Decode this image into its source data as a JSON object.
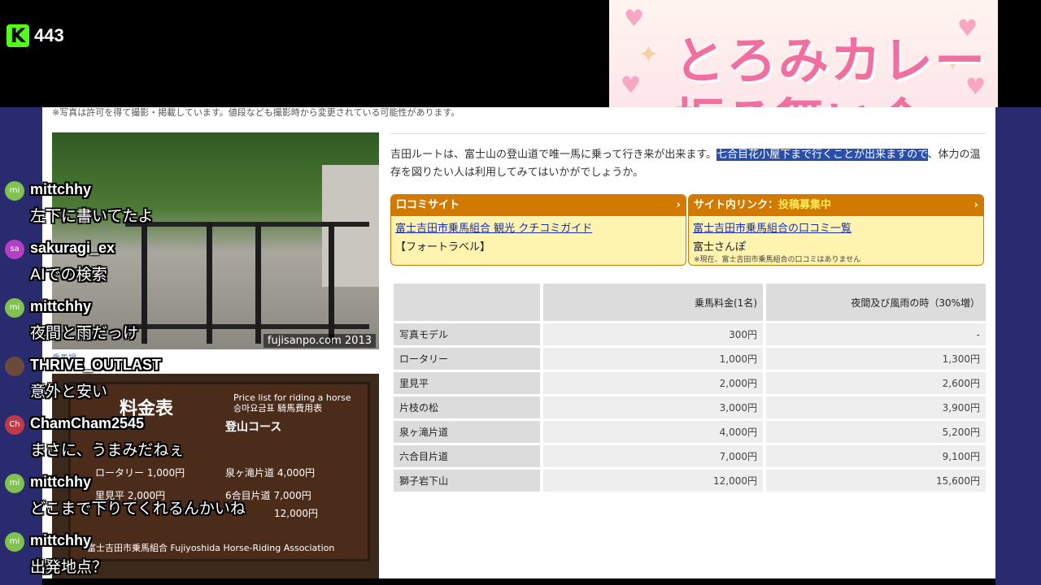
{
  "stream": {
    "viewer_count": "443",
    "banner_line1": "とろみカレー",
    "banner_line2": "振る舞い会"
  },
  "page": {
    "notice": "※写真は許可を得て撮影・掲載しています。値段なども撮影時から変更されている可能性があります。",
    "photo_credit": "fujisanpo.com 2013",
    "photo_caption": "乗馬場",
    "intro_before": "吉田ルートは、富士山の登山道で唯一馬に乗って行き来が出来ます。",
    "intro_selected": "七合目花小屋下まで行くことが出来ますので",
    "intro_after": "、体力の温存を図りたい人は利用してみてはいかがでしょうか。",
    "sign": {
      "title": "料金表",
      "title_en": "Price list for riding a horse",
      "title_kr": "승마요금표 騎馬費用表",
      "course": "登山コース",
      "rows": [
        "ロータリー 1,000円",
        "里見平 2,000円",
        "泉ヶ滝片道 4,000円",
        "6合目片道 7,000円",
        "12,000円"
      ],
      "footer": "富士吉田市乗馬組合 Fujiyoshida Horse-Riding Association"
    },
    "box_left": {
      "header": "口コミサイト",
      "link": "富士吉田市乗馬組合 観光 クチコミガイド",
      "sub": "【フォートラベル】"
    },
    "box_right": {
      "header_prefix": "サイト内リンク：",
      "header_accent": "投稿募集中",
      "link": "富士吉田市乗馬組合の口コミ一覧",
      "sub": "富士さんぽ",
      "note": "※現在、富士吉田市乗馬組合の口コミはありません"
    },
    "table": {
      "headers": [
        "",
        "乗馬料金(1名)",
        "夜間及び風雨の時（30%増）"
      ],
      "rows": [
        [
          "写真モデル",
          "300円",
          "-"
        ],
        [
          "ロータリー",
          "1,000円",
          "1,300円"
        ],
        [
          "里見平",
          "2,000円",
          "2,600円"
        ],
        [
          "片枝の松",
          "3,000円",
          "3,900円"
        ],
        [
          "泉ヶ滝片道",
          "4,000円",
          "5,200円"
        ],
        [
          "六合目片道",
          "7,000円",
          "9,100円"
        ],
        [
          "獅子岩下山",
          "12,000円",
          "15,600円"
        ]
      ]
    }
  },
  "chat": [
    {
      "user": "mittchhy",
      "avatar": "mi",
      "color": "#7fc24d",
      "text": "左下に書いてたよ"
    },
    {
      "user": "sakuragi_ex",
      "avatar": "sa",
      "color": "#b43fc4",
      "text": "AIでの検索"
    },
    {
      "user": "mittchhy",
      "avatar": "mi",
      "color": "#7fc24d",
      "text": "夜間と雨だっけ"
    },
    {
      "user": "THRIVE_OUTLAST",
      "avatar": "",
      "color": "#6a4a3a",
      "text": "意外と安い"
    },
    {
      "user": "ChamCham2545",
      "avatar": "Ch",
      "color": "#c0394b",
      "text": "まさに、うまみだねぇ"
    },
    {
      "user": "mittchhy",
      "avatar": "mi",
      "color": "#7fc24d",
      "text": "どこまで下りてくれるんかいね"
    },
    {
      "user": "mittchhy",
      "avatar": "mi",
      "color": "#7fc24d",
      "text": "出発地点？"
    }
  ]
}
